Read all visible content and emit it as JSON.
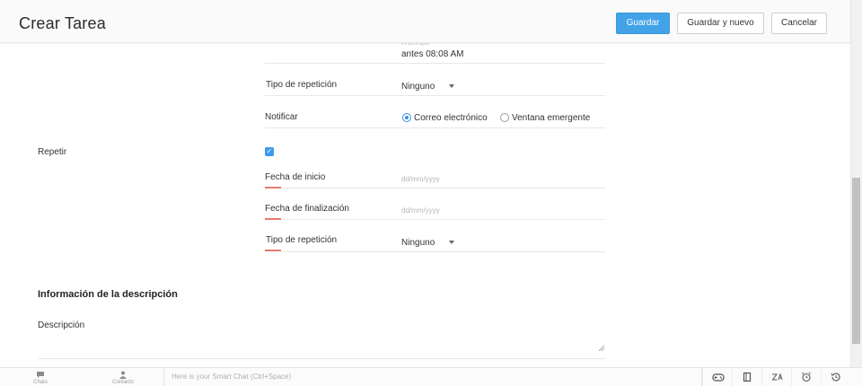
{
  "header": {
    "title": "Crear Tarea",
    "save_label": "Guardar",
    "save_new_label": "Guardar y nuevo",
    "cancel_label": "Cancelar"
  },
  "form": {
    "reminder_partial_label": "A tiempo",
    "reminder_value": "antes   08:08 AM",
    "repeat_type_1": {
      "label": "Tipo de repetición",
      "value": "Ninguno"
    },
    "notify": {
      "label": "Notificar",
      "options": [
        {
          "label": "Correo electrónico",
          "selected": true
        },
        {
          "label": "Ventana emergente",
          "selected": false
        }
      ]
    },
    "repeat": {
      "label": "Repetir",
      "checked": true
    },
    "start_date": {
      "label": "Fecha de inicio",
      "placeholder": "dd/mm/yyyy"
    },
    "end_date": {
      "label": "Fecha de finalización",
      "placeholder": "dd/mm/yyyy"
    },
    "repeat_type_2": {
      "label": "Tipo de repetición",
      "value": "Ninguno"
    }
  },
  "description_section": {
    "title": "Información de la descripción",
    "field_label": "Descripción"
  },
  "footer": {
    "chats_label": "Chats",
    "contacts_label": "Contacts",
    "smart_chat_placeholder": "Here is your Smart Chat (Ctrl+Space)",
    "icons": [
      "gamepad-icon",
      "notebook-icon",
      "translate-icon",
      "alarm-clock-icon",
      "history-icon"
    ]
  },
  "colors": {
    "primary": "#43a3e8",
    "required_marker": "#e57b6d",
    "radio_selected": "#3a8ee0"
  }
}
